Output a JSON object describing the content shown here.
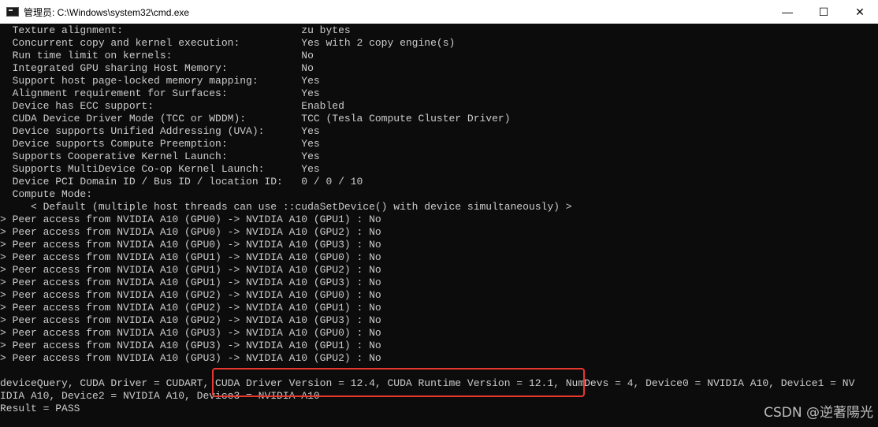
{
  "window": {
    "title": "管理员: C:\\Windows\\system32\\cmd.exe",
    "minimize_glyph": "—",
    "maximize_glyph": "☐",
    "close_glyph": "✕"
  },
  "console": {
    "lines": [
      "  Texture alignment:                             zu bytes",
      "  Concurrent copy and kernel execution:          Yes with 2 copy engine(s)",
      "  Run time limit on kernels:                     No",
      "  Integrated GPU sharing Host Memory:            No",
      "  Support host page-locked memory mapping:       Yes",
      "  Alignment requirement for Surfaces:            Yes",
      "  Device has ECC support:                        Enabled",
      "  CUDA Device Driver Mode (TCC or WDDM):         TCC (Tesla Compute Cluster Driver)",
      "  Device supports Unified Addressing (UVA):      Yes",
      "  Device supports Compute Preemption:            Yes",
      "  Supports Cooperative Kernel Launch:            Yes",
      "  Supports MultiDevice Co-op Kernel Launch:      Yes",
      "  Device PCI Domain ID / Bus ID / location ID:   0 / 0 / 10",
      "  Compute Mode:",
      "     < Default (multiple host threads can use ::cudaSetDevice() with device simultaneously) >",
      "> Peer access from NVIDIA A10 (GPU0) -> NVIDIA A10 (GPU1) : No",
      "> Peer access from NVIDIA A10 (GPU0) -> NVIDIA A10 (GPU2) : No",
      "> Peer access from NVIDIA A10 (GPU0) -> NVIDIA A10 (GPU3) : No",
      "> Peer access from NVIDIA A10 (GPU1) -> NVIDIA A10 (GPU0) : No",
      "> Peer access from NVIDIA A10 (GPU1) -> NVIDIA A10 (GPU2) : No",
      "> Peer access from NVIDIA A10 (GPU1) -> NVIDIA A10 (GPU3) : No",
      "> Peer access from NVIDIA A10 (GPU2) -> NVIDIA A10 (GPU0) : No",
      "> Peer access from NVIDIA A10 (GPU2) -> NVIDIA A10 (GPU1) : No",
      "> Peer access from NVIDIA A10 (GPU2) -> NVIDIA A10 (GPU3) : No",
      "> Peer access from NVIDIA A10 (GPU3) -> NVIDIA A10 (GPU0) : No",
      "> Peer access from NVIDIA A10 (GPU3) -> NVIDIA A10 (GPU1) : No",
      "> Peer access from NVIDIA A10 (GPU3) -> NVIDIA A10 (GPU2) : No",
      "",
      "deviceQuery, CUDA Driver = CUDART, CUDA Driver Version = 12.4, CUDA Runtime Version = 12.1, NumDevs = 4, Device0 = NVIDIA A10, Device1 = NV",
      "IDIA A10, Device2 = NVIDIA A10, Device3 = NVIDIA A10",
      "Result = PASS"
    ]
  },
  "highlight_color": "#e8372f",
  "watermark": "CSDN @逆著陽光"
}
